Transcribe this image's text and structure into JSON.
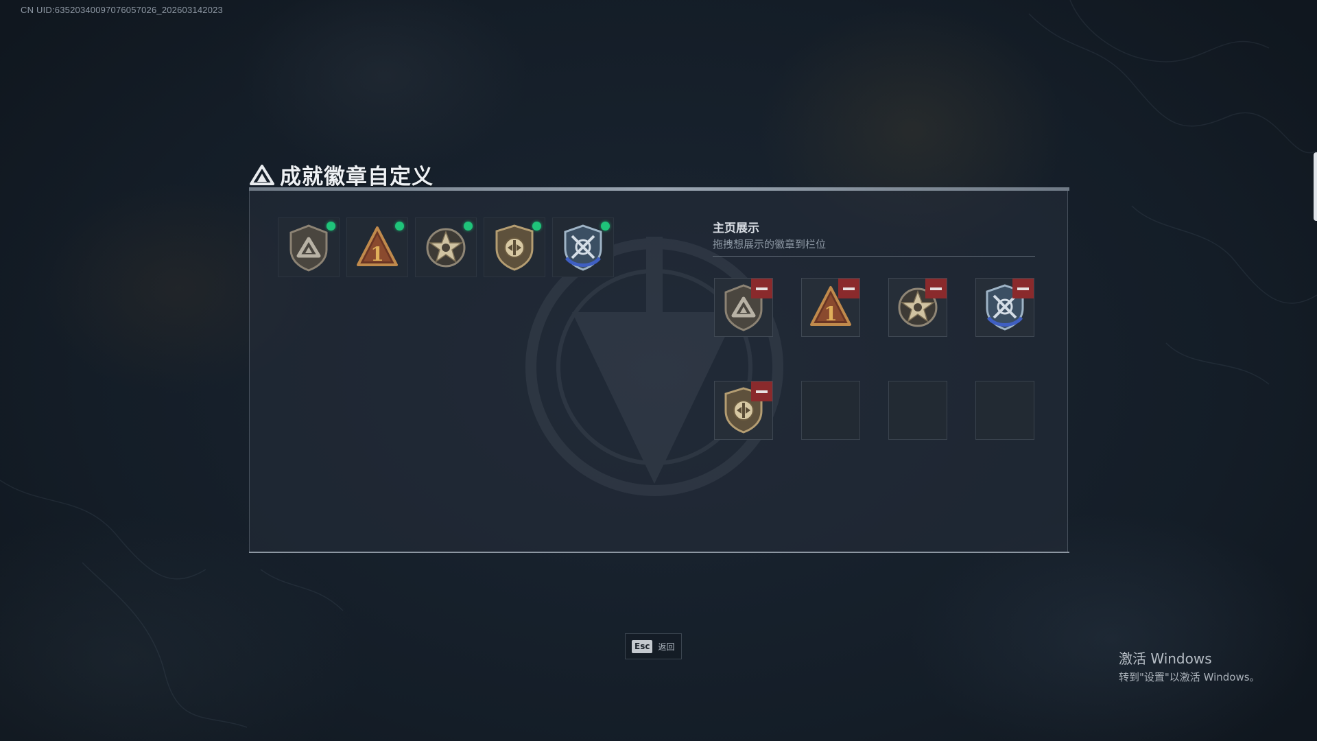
{
  "uid_text": "CN UID:635203400970760570​26_202603142023",
  "title": "成就徽章自定义",
  "inventory": {
    "badges": [
      {
        "icon": "shield-triangle-badge-icon",
        "new": true
      },
      {
        "icon": "bronze-number-one-badge-icon",
        "new": true
      },
      {
        "icon": "star-emblem-badge-icon",
        "new": true
      },
      {
        "icon": "shield-medallion-badge-icon",
        "new": true
      },
      {
        "icon": "blue-crossed-swords-badge-icon",
        "new": true
      }
    ]
  },
  "showcase": {
    "title": "主页展示",
    "subtitle": "拖拽想展示的徽章到栏位",
    "slots": [
      {
        "icon": "shield-triangle-badge-icon",
        "filled": true
      },
      {
        "icon": "bronze-number-one-badge-icon",
        "filled": true
      },
      {
        "icon": "star-emblem-badge-icon",
        "filled": true
      },
      {
        "icon": "blue-crossed-swords-badge-icon",
        "filled": true
      },
      {
        "icon": "shield-medallion-badge-icon",
        "filled": true
      },
      {
        "filled": false
      },
      {
        "filled": false
      },
      {
        "filled": false
      }
    ]
  },
  "footer": {
    "esc_key": "Esc",
    "esc_label": "返回"
  },
  "windows_activation": {
    "title": "激活 Windows",
    "subtitle": "转到\"设置\"以激活 Windows。"
  },
  "colors": {
    "new_indicator": "#1fc47a",
    "remove_button": "#8a2a2c",
    "background": "#141d27"
  }
}
